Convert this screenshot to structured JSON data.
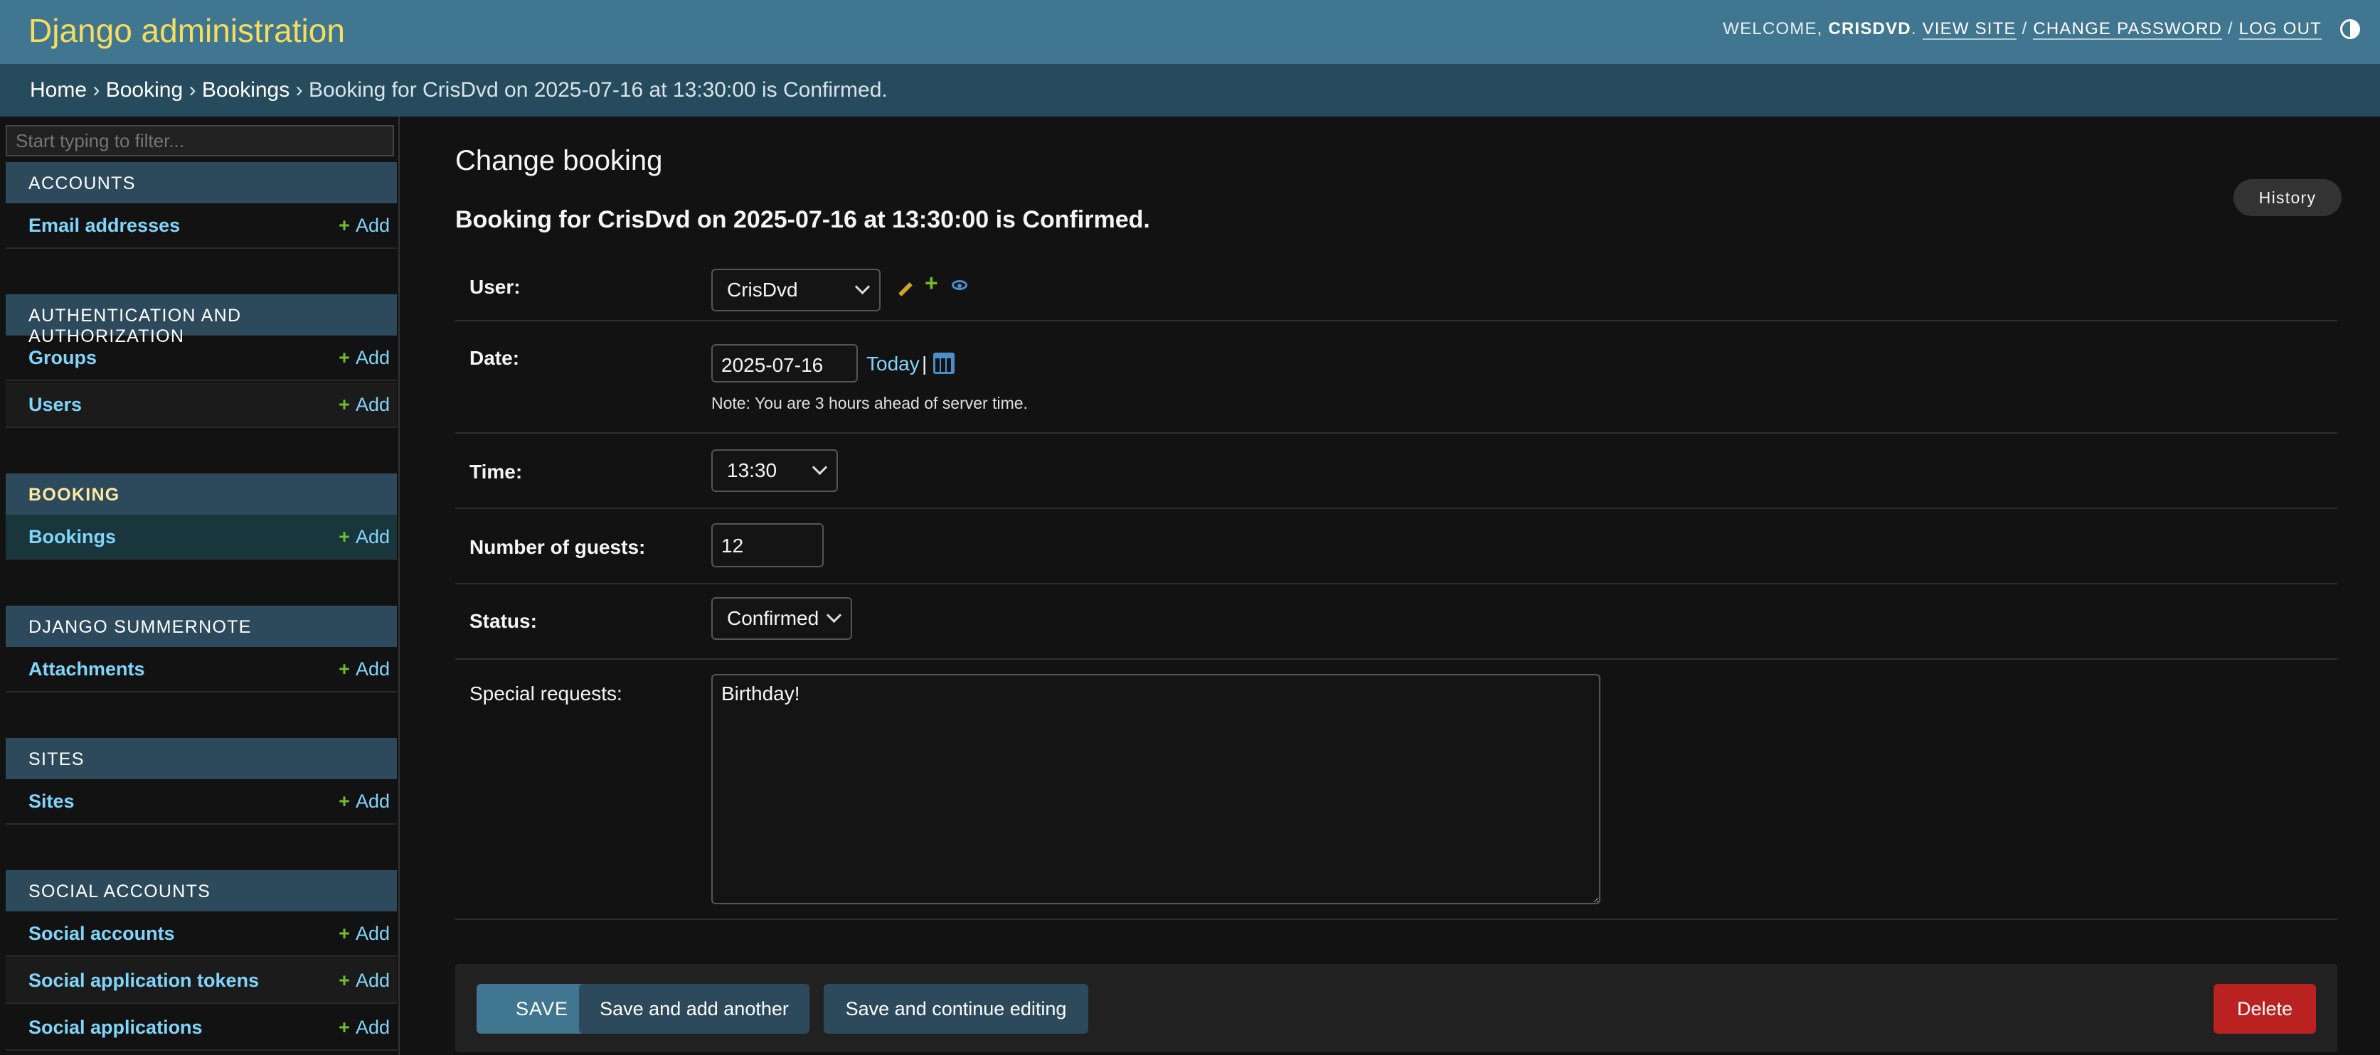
{
  "header": {
    "brand": "Django administration",
    "welcome": "Welcome,",
    "username": "CrisDvd",
    "view_site": "View site",
    "change_password": "Change password",
    "log_out": "Log out",
    "separator": "/"
  },
  "breadcrumbs": {
    "home": "Home",
    "app": "Booking",
    "model": "Bookings",
    "current": "Booking for CrisDvd on 2025-07-16 at 13:30:00 is Confirmed.",
    "sep": "›"
  },
  "sidebar": {
    "filter_placeholder": "Start typing to filter...",
    "add_label": "Add",
    "modules": [
      {
        "caption": "Accounts",
        "items": [
          {
            "name": "Email addresses"
          }
        ]
      },
      {
        "caption": "Authentication and Authorization",
        "items": [
          {
            "name": "Groups"
          },
          {
            "name": "Users"
          }
        ]
      },
      {
        "caption": "Booking",
        "items": [
          {
            "name": "Bookings"
          }
        ]
      },
      {
        "caption": "Django Summernote",
        "items": [
          {
            "name": "Attachments"
          }
        ]
      },
      {
        "caption": "Sites",
        "items": [
          {
            "name": "Sites"
          }
        ]
      },
      {
        "caption": "Social Accounts",
        "items": [
          {
            "name": "Social accounts"
          },
          {
            "name": "Social application tokens"
          },
          {
            "name": "Social applications"
          }
        ]
      }
    ]
  },
  "main": {
    "title": "Change booking",
    "history_label": "History",
    "object_title": "Booking for CrisDvd on 2025-07-16 at 13:30:00 is Confirmed.",
    "fields": {
      "user": {
        "label": "User:",
        "value": "CrisDvd"
      },
      "date": {
        "label": "Date:",
        "value": "2025-07-16",
        "today": "Today",
        "pipe": "|",
        "note": "Note: You are 3 hours ahead of server time."
      },
      "time": {
        "label": "Time:",
        "value": "13:30"
      },
      "guests": {
        "label": "Number of guests:",
        "value": "12"
      },
      "status": {
        "label": "Status:",
        "value": "Confirmed"
      },
      "special_requests": {
        "label": "Special requests:",
        "value": "Birthday!"
      }
    },
    "buttons": {
      "save": "SAVE",
      "save_add_another": "Save and add another",
      "save_continue": "Save and continue editing",
      "delete": "Delete"
    }
  },
  "colors": {
    "header_bg": "#417690",
    "brand": "#f5dd5d",
    "breadcrumb_bg": "#264b5d",
    "link": "#81d4fa",
    "add_plus": "#70bf2b",
    "delete": "#ba2121"
  }
}
